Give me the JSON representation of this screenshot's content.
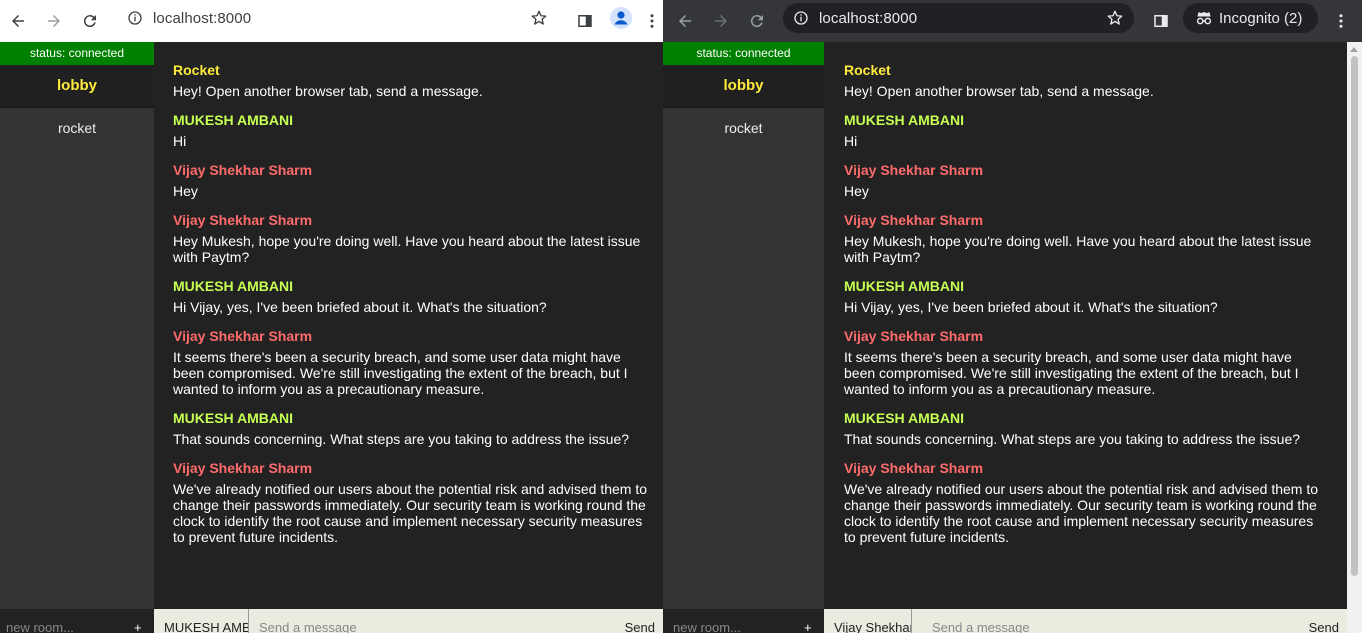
{
  "left": {
    "url": "localhost:8000",
    "status": "status: connected",
    "rooms": [
      "lobby",
      "rocket"
    ],
    "new_room_placeholder": "new room...",
    "add_room": "+",
    "username": "MUKESH AMBANI",
    "message_placeholder": "Send a message",
    "send_label": "Send"
  },
  "right": {
    "url": "localhost:8000",
    "incognito_label": "Incognito (2)",
    "status": "status: connected",
    "rooms": [
      "lobby",
      "rocket"
    ],
    "new_room_placeholder": "new room...",
    "add_room": "+",
    "username": "Vijay Shekhar Sharm",
    "message_placeholder": "Send a message",
    "send_label": "Send"
  },
  "messages": [
    {
      "sender": "Rocket",
      "text": "Hey! Open another browser tab, send a message."
    },
    {
      "sender": "MUKESH AMBANI",
      "text": "Hi"
    },
    {
      "sender": "Vijay Shekhar Sharm",
      "text": "Hey"
    },
    {
      "sender": "Vijay Shekhar Sharm",
      "text": "Hey Mukesh, hope you're doing well. Have you heard about the latest issue with Paytm?"
    },
    {
      "sender": "MUKESH AMBANI",
      "text": "Hi Vijay, yes, I've been briefed about it. What's the situation?"
    },
    {
      "sender": "Vijay Shekhar Sharm",
      "text": "It seems there's been a security breach, and some user data might have been compromised. We're still investigating the extent of the breach, but I wanted to inform you as a precautionary measure."
    },
    {
      "sender": "MUKESH AMBANI",
      "text": "That sounds concerning. What steps are you taking to address the issue?"
    },
    {
      "sender": "Vijay Shekhar Sharm",
      "text": "We've already notified our users about the potential risk and advised them to change their passwords immediately. Our security team is working round the clock to identify the root cause and implement necessary security measures to prevent future incidents."
    }
  ],
  "colors": {
    "status_bg": "#008000",
    "rocket": "#ffeb3b",
    "mukesh": "#c6ff54",
    "vijay": "#ff6b6b",
    "chat_bg": "#222222",
    "sidebar_bg": "#333333"
  },
  "icons": [
    "back-arrow-icon",
    "forward-arrow-icon",
    "reload-icon",
    "info-icon",
    "star-icon",
    "side-panel-icon",
    "profile-icon",
    "kebab-menu-icon",
    "incognito-icon"
  ]
}
